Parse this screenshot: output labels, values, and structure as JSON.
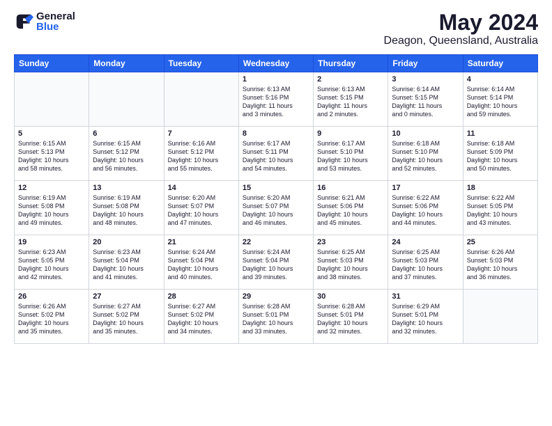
{
  "header": {
    "logo_general": "General",
    "logo_blue": "Blue",
    "month": "May 2024",
    "location": "Deagon, Queensland, Australia"
  },
  "weekdays": [
    "Sunday",
    "Monday",
    "Tuesday",
    "Wednesday",
    "Thursday",
    "Friday",
    "Saturday"
  ],
  "weeks": [
    [
      {
        "day": "",
        "info": ""
      },
      {
        "day": "",
        "info": ""
      },
      {
        "day": "",
        "info": ""
      },
      {
        "day": "1",
        "info": "Sunrise: 6:13 AM\nSunset: 5:16 PM\nDaylight: 11 hours\nand 3 minutes."
      },
      {
        "day": "2",
        "info": "Sunrise: 6:13 AM\nSunset: 5:15 PM\nDaylight: 11 hours\nand 2 minutes."
      },
      {
        "day": "3",
        "info": "Sunrise: 6:14 AM\nSunset: 5:15 PM\nDaylight: 11 hours\nand 0 minutes."
      },
      {
        "day": "4",
        "info": "Sunrise: 6:14 AM\nSunset: 5:14 PM\nDaylight: 10 hours\nand 59 minutes."
      }
    ],
    [
      {
        "day": "5",
        "info": "Sunrise: 6:15 AM\nSunset: 5:13 PM\nDaylight: 10 hours\nand 58 minutes."
      },
      {
        "day": "6",
        "info": "Sunrise: 6:15 AM\nSunset: 5:12 PM\nDaylight: 10 hours\nand 56 minutes."
      },
      {
        "day": "7",
        "info": "Sunrise: 6:16 AM\nSunset: 5:12 PM\nDaylight: 10 hours\nand 55 minutes."
      },
      {
        "day": "8",
        "info": "Sunrise: 6:17 AM\nSunset: 5:11 PM\nDaylight: 10 hours\nand 54 minutes."
      },
      {
        "day": "9",
        "info": "Sunrise: 6:17 AM\nSunset: 5:10 PM\nDaylight: 10 hours\nand 53 minutes."
      },
      {
        "day": "10",
        "info": "Sunrise: 6:18 AM\nSunset: 5:10 PM\nDaylight: 10 hours\nand 52 minutes."
      },
      {
        "day": "11",
        "info": "Sunrise: 6:18 AM\nSunset: 5:09 PM\nDaylight: 10 hours\nand 50 minutes."
      }
    ],
    [
      {
        "day": "12",
        "info": "Sunrise: 6:19 AM\nSunset: 5:08 PM\nDaylight: 10 hours\nand 49 minutes."
      },
      {
        "day": "13",
        "info": "Sunrise: 6:19 AM\nSunset: 5:08 PM\nDaylight: 10 hours\nand 48 minutes."
      },
      {
        "day": "14",
        "info": "Sunrise: 6:20 AM\nSunset: 5:07 PM\nDaylight: 10 hours\nand 47 minutes."
      },
      {
        "day": "15",
        "info": "Sunrise: 6:20 AM\nSunset: 5:07 PM\nDaylight: 10 hours\nand 46 minutes."
      },
      {
        "day": "16",
        "info": "Sunrise: 6:21 AM\nSunset: 5:06 PM\nDaylight: 10 hours\nand 45 minutes."
      },
      {
        "day": "17",
        "info": "Sunrise: 6:22 AM\nSunset: 5:06 PM\nDaylight: 10 hours\nand 44 minutes."
      },
      {
        "day": "18",
        "info": "Sunrise: 6:22 AM\nSunset: 5:05 PM\nDaylight: 10 hours\nand 43 minutes."
      }
    ],
    [
      {
        "day": "19",
        "info": "Sunrise: 6:23 AM\nSunset: 5:05 PM\nDaylight: 10 hours\nand 42 minutes."
      },
      {
        "day": "20",
        "info": "Sunrise: 6:23 AM\nSunset: 5:04 PM\nDaylight: 10 hours\nand 41 minutes."
      },
      {
        "day": "21",
        "info": "Sunrise: 6:24 AM\nSunset: 5:04 PM\nDaylight: 10 hours\nand 40 minutes."
      },
      {
        "day": "22",
        "info": "Sunrise: 6:24 AM\nSunset: 5:04 PM\nDaylight: 10 hours\nand 39 minutes."
      },
      {
        "day": "23",
        "info": "Sunrise: 6:25 AM\nSunset: 5:03 PM\nDaylight: 10 hours\nand 38 minutes."
      },
      {
        "day": "24",
        "info": "Sunrise: 6:25 AM\nSunset: 5:03 PM\nDaylight: 10 hours\nand 37 minutes."
      },
      {
        "day": "25",
        "info": "Sunrise: 6:26 AM\nSunset: 5:03 PM\nDaylight: 10 hours\nand 36 minutes."
      }
    ],
    [
      {
        "day": "26",
        "info": "Sunrise: 6:26 AM\nSunset: 5:02 PM\nDaylight: 10 hours\nand 35 minutes."
      },
      {
        "day": "27",
        "info": "Sunrise: 6:27 AM\nSunset: 5:02 PM\nDaylight: 10 hours\nand 35 minutes."
      },
      {
        "day": "28",
        "info": "Sunrise: 6:27 AM\nSunset: 5:02 PM\nDaylight: 10 hours\nand 34 minutes."
      },
      {
        "day": "29",
        "info": "Sunrise: 6:28 AM\nSunset: 5:01 PM\nDaylight: 10 hours\nand 33 minutes."
      },
      {
        "day": "30",
        "info": "Sunrise: 6:28 AM\nSunset: 5:01 PM\nDaylight: 10 hours\nand 32 minutes."
      },
      {
        "day": "31",
        "info": "Sunrise: 6:29 AM\nSunset: 5:01 PM\nDaylight: 10 hours\nand 32 minutes."
      },
      {
        "day": "",
        "info": ""
      }
    ]
  ]
}
